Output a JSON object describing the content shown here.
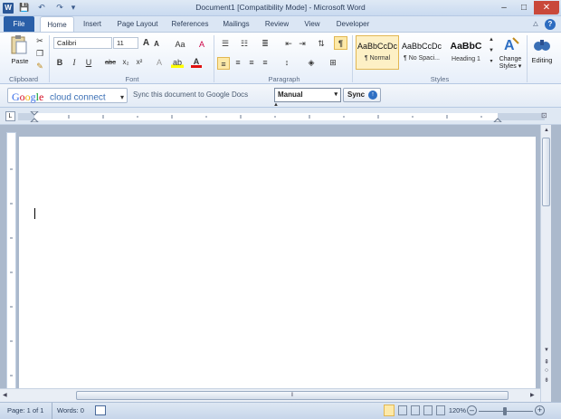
{
  "window": {
    "title": "Document1 [Compatibility Mode] - Microsoft Word",
    "app_icon_letter": "W",
    "controls": {
      "minimize": "–",
      "maximize": "□",
      "close": "✕"
    }
  },
  "quick_access": {
    "save": "💾",
    "undo": "↶",
    "redo": "↷",
    "customize": "▾"
  },
  "tabs": [
    {
      "label": "File"
    },
    {
      "label": "Home"
    },
    {
      "label": "Insert"
    },
    {
      "label": "Page Layout"
    },
    {
      "label": "References"
    },
    {
      "label": "Mailings"
    },
    {
      "label": "Review"
    },
    {
      "label": "View"
    },
    {
      "label": "Developer"
    }
  ],
  "help": {
    "minimize_ribbon": "△",
    "help": "?"
  },
  "ribbon": {
    "clipboard": {
      "label": "Clipboard",
      "paste_label": "Paste"
    },
    "font": {
      "label": "Font",
      "name": "Calibri",
      "size": "11",
      "grow": "A",
      "shrink": "A",
      "change_case": "Aa",
      "clear_format": "A",
      "bold": "B",
      "italic": "I",
      "underline": "U",
      "strike": "abc",
      "subscript": "x₂",
      "superscript": "x²",
      "highlight": "ab",
      "font_color": "A"
    },
    "paragraph": {
      "label": "Paragraph",
      "pilcrow": "¶"
    },
    "styles": {
      "label": "Styles",
      "items": [
        {
          "sample": "AaBbCcDc",
          "name": "¶ Normal"
        },
        {
          "sample": "AaBbCcDc",
          "name": "¶ No Spaci..."
        },
        {
          "sample": "AaBbC",
          "name": "Heading 1"
        }
      ],
      "change_styles": "Change Styles ▾"
    },
    "editing": {
      "label": "Editing"
    }
  },
  "google_bar": {
    "brand_google": "Google",
    "brand_product": "cloud connect",
    "dropdown": "▾",
    "sync_text": "Sync this document to Google Docs",
    "mode_value": "Manual",
    "sync_button": "Sync",
    "colors": {
      "blue": "#3369e8",
      "red": "#d50f25",
      "yellow": "#eeb211",
      "green": "#009925"
    }
  },
  "document": {
    "text": ""
  },
  "status": {
    "page": "Page: 1 of 1",
    "words": "Words: 0",
    "zoom": "120%",
    "zoom_out": "–",
    "zoom_in": "+"
  }
}
